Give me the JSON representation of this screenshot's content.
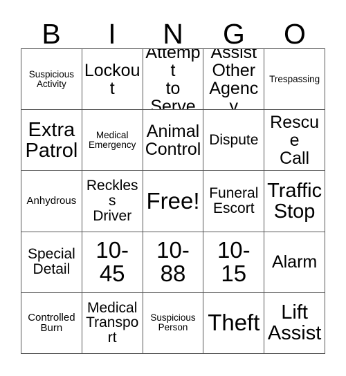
{
  "card": {
    "header_letters": [
      "B",
      "I",
      "N",
      "G",
      "O"
    ],
    "columns": 5,
    "rows": 5,
    "free_space_label": "Free!",
    "colors": {
      "background": "#ffffff",
      "text": "#000000",
      "grid_line": "#555555"
    },
    "cells": [
      {
        "text": "Suspicious\nActivity",
        "size": "xs",
        "column": "B",
        "row": 1
      },
      {
        "text": "Lockout",
        "size": "lg",
        "column": "I",
        "row": 1
      },
      {
        "text": "Attempt\nto\nServe",
        "size": "lg",
        "column": "N",
        "row": 1
      },
      {
        "text": "Assist\nOther\nAgency",
        "size": "lg",
        "column": "G",
        "row": 1
      },
      {
        "text": "Trespassing",
        "size": "xs",
        "column": "O",
        "row": 1
      },
      {
        "text": "Extra\nPatrol",
        "size": "xl",
        "column": "B",
        "row": 2
      },
      {
        "text": "Medical\nEmergency",
        "size": "xs",
        "column": "I",
        "row": 2
      },
      {
        "text": "Animal\nControl",
        "size": "lg",
        "column": "N",
        "row": 2
      },
      {
        "text": "Dispute",
        "size": "md",
        "column": "G",
        "row": 2
      },
      {
        "text": "Rescue\nCall",
        "size": "lg",
        "column": "O",
        "row": 2
      },
      {
        "text": "Anhydrous",
        "size": "sm",
        "column": "B",
        "row": 3
      },
      {
        "text": "Reckless\nDriver",
        "size": "md",
        "column": "I",
        "row": 3
      },
      {
        "text": "Free!",
        "size": "xxl",
        "column": "N",
        "row": 3,
        "free_space": true
      },
      {
        "text": "Funeral\nEscort",
        "size": "md",
        "column": "G",
        "row": 3
      },
      {
        "text": "Traffic\nStop",
        "size": "xl",
        "column": "O",
        "row": 3
      },
      {
        "text": "Special\nDetail",
        "size": "md",
        "column": "B",
        "row": 4
      },
      {
        "text": "10-\n45",
        "size": "xxl",
        "column": "I",
        "row": 4
      },
      {
        "text": "10-\n88",
        "size": "xxl",
        "column": "N",
        "row": 4
      },
      {
        "text": "10-\n15",
        "size": "xxl",
        "column": "G",
        "row": 4
      },
      {
        "text": "Alarm",
        "size": "lg",
        "column": "O",
        "row": 4
      },
      {
        "text": "Controlled\nBurn",
        "size": "sm",
        "column": "B",
        "row": 5
      },
      {
        "text": "Medical\nTransport",
        "size": "md",
        "column": "I",
        "row": 5
      },
      {
        "text": "Suspicious\nPerson",
        "size": "xs",
        "column": "N",
        "row": 5
      },
      {
        "text": "Theft",
        "size": "xxl",
        "column": "G",
        "row": 5
      },
      {
        "text": "Lift\nAssist",
        "size": "xl",
        "column": "O",
        "row": 5
      }
    ]
  }
}
